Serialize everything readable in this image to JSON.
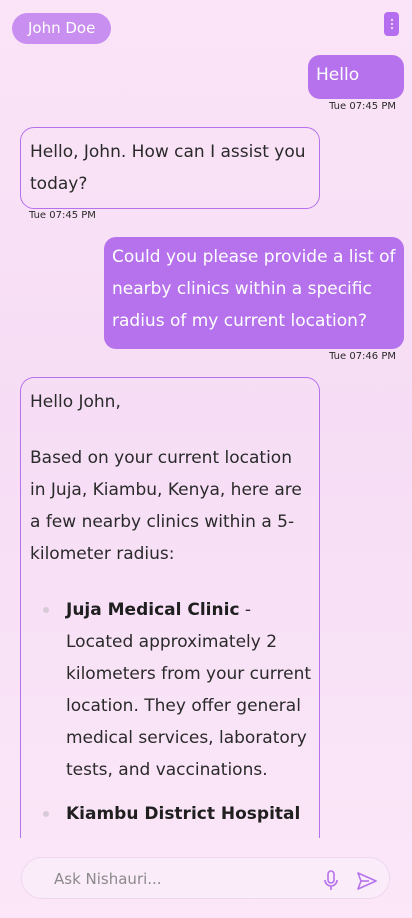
{
  "header": {
    "user_name": "John Doe",
    "menu_icon": "more-vertical-icon"
  },
  "messages": [
    {
      "from": "user",
      "text": "Hello",
      "time": "Tue 07:45 PM"
    },
    {
      "from": "bot",
      "text": "Hello, John. How can I assist you today?",
      "time": "Tue 07:45 PM"
    },
    {
      "from": "user",
      "text": "Could you please provide a list of nearby clinics within a specific radius of my current location?",
      "time": "Tue 07:46 PM"
    },
    {
      "from": "bot",
      "greeting": "Hello John,",
      "intro": "Based on your current location in Juja, Kiambu, Kenya, here are a few nearby clinics within a 5-kilometer radius:",
      "clinics": [
        {
          "name": "Juja Medical Clinic",
          "detail": " - Located approximately 2 kilometers from your current location. They offer general medical services, laboratory tests, and vaccinations."
        },
        {
          "name": "Kiambu District Hospital",
          "detail": " -"
        }
      ]
    }
  ],
  "composer": {
    "placeholder": "Ask Nishauri...",
    "mic_icon": "microphone-icon",
    "send_icon": "send-icon"
  },
  "colors": {
    "accent": "#b672ec",
    "chip": "#c88ef0",
    "background": "#fbe4f7"
  }
}
